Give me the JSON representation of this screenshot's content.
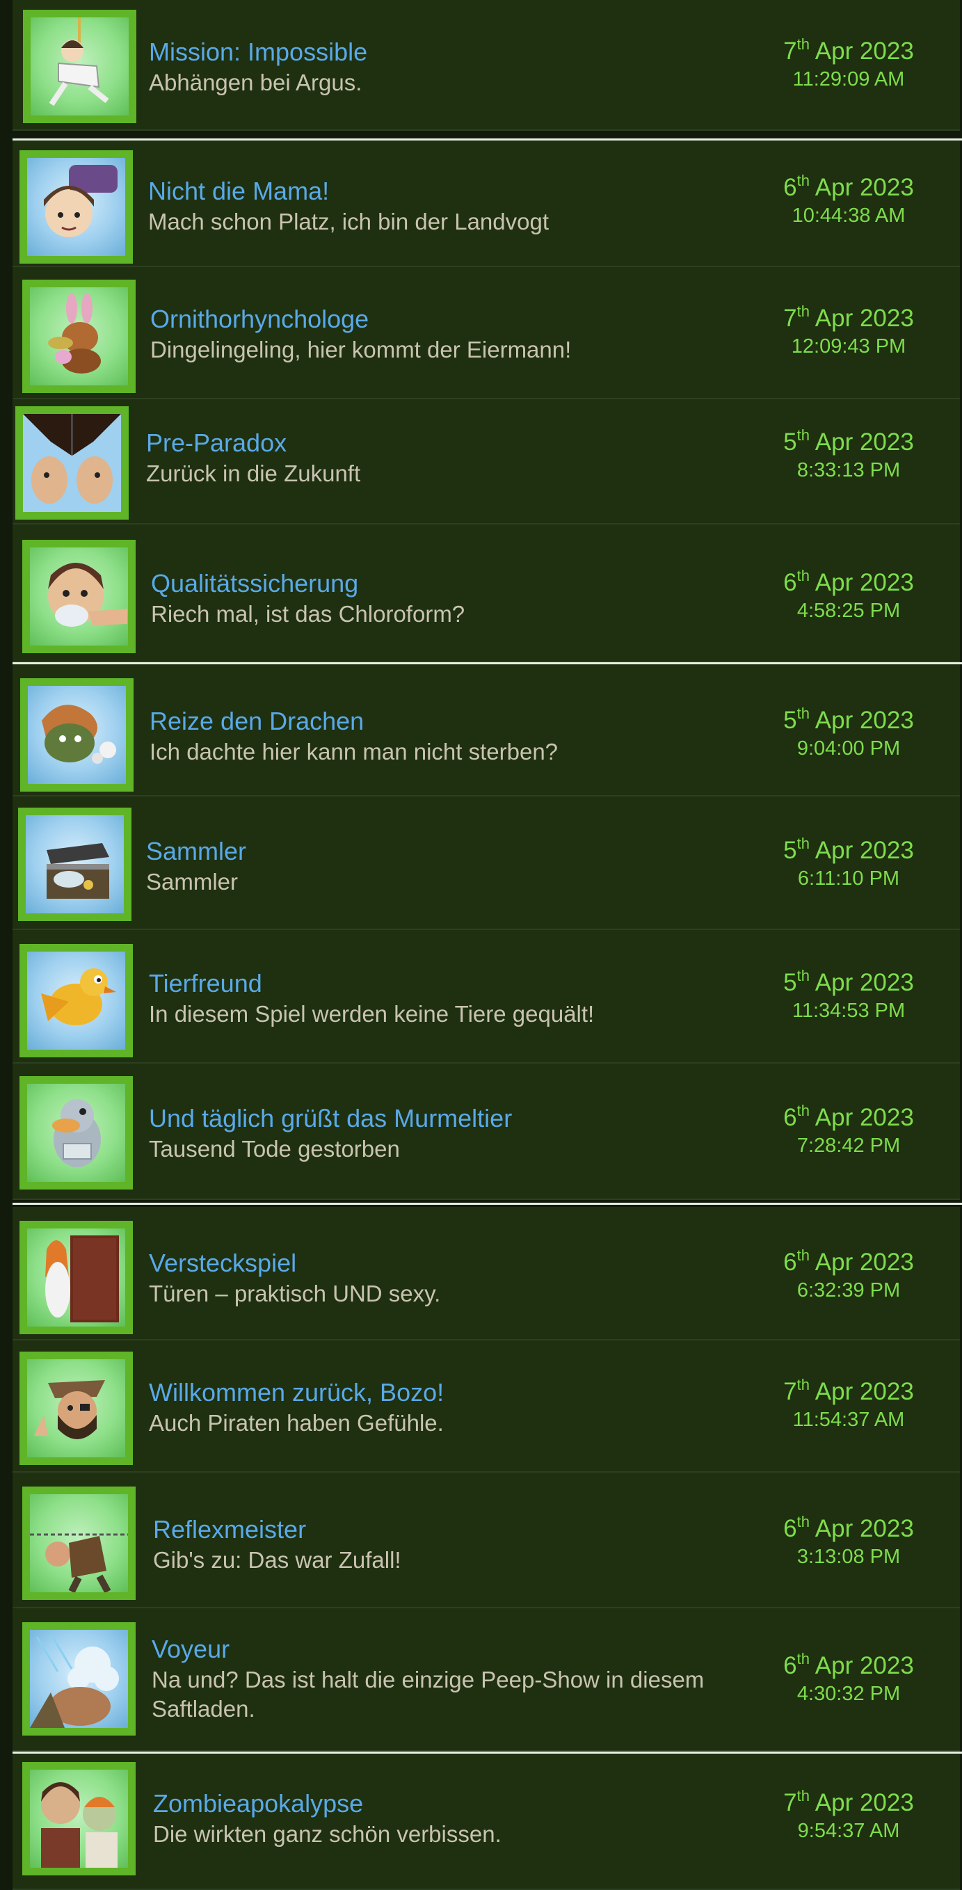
{
  "achievements": [
    {
      "title": "Mission: Impossible",
      "description": "Abhängen bei Argus.",
      "day": "7",
      "suffix": "th",
      "month_year": "Apr 2023",
      "time": "11:29:09 AM",
      "icon": "hanging-character-icon"
    },
    {
      "title": "Nicht die Mama!",
      "description": "Mach schon Platz, ich bin der Landvogt",
      "day": "6",
      "suffix": "th",
      "month_year": "Apr 2023",
      "time": "10:44:38 AM",
      "icon": "hammer-character-icon"
    },
    {
      "title": "Ornithorhynchologe",
      "description": "Dingelingeling, hier kommt der Eiermann!",
      "day": "7",
      "suffix": "th",
      "month_year": "Apr 2023",
      "time": "12:09:43 PM",
      "icon": "bunny-platypus-icon"
    },
    {
      "title": "Pre-Paradox",
      "description": "Zurück in die Zukunft",
      "day": "5",
      "suffix": "th",
      "month_year": "Apr 2023",
      "time": "8:33:13 PM",
      "icon": "two-faces-icon"
    },
    {
      "title": "Qualitätssicherung",
      "description": "Riech mal, ist das Chloroform?",
      "day": "6",
      "suffix": "th",
      "month_year": "Apr 2023",
      "time": "4:58:25 PM",
      "icon": "chloroform-character-icon"
    },
    {
      "title": "Reize den Drachen",
      "description": "Ich dachte hier kann man nicht sterben?",
      "day": "5",
      "suffix": "th",
      "month_year": "Apr 2023",
      "time": "9:04:00 PM",
      "icon": "dragon-icon"
    },
    {
      "title": "Sammler",
      "description": "Sammler",
      "day": "5",
      "suffix": "th",
      "month_year": "Apr 2023",
      "time": "6:11:10 PM",
      "icon": "treasure-chest-icon"
    },
    {
      "title": "Tierfreund",
      "description": "In diesem Spiel werden keine Tiere gequält!",
      "day": "5",
      "suffix": "th",
      "month_year": "Apr 2023",
      "time": "11:34:53 PM",
      "icon": "yellow-bird-icon"
    },
    {
      "title": "Und täglich grüßt das Murmeltier",
      "description": "Tausend Tode gestorben",
      "day": "6",
      "suffix": "th",
      "month_year": "Apr 2023",
      "time": "7:28:42 PM",
      "icon": "platypus-icon"
    },
    {
      "title": "Versteckspiel",
      "description": "Türen – praktisch UND sexy.",
      "day": "6",
      "suffix": "th",
      "month_year": "Apr 2023",
      "time": "6:32:39 PM",
      "icon": "door-woman-icon"
    },
    {
      "title": "Willkommen zurück, Bozo!",
      "description": "Auch Piraten haben Gefühle.",
      "day": "7",
      "suffix": "th",
      "month_year": "Apr 2023",
      "time": "11:54:37 AM",
      "icon": "pirate-icon"
    },
    {
      "title": "Reflexmeister",
      "description": "Gib's zu: Das war Zufall!",
      "day": "6",
      "suffix": "th",
      "month_year": "Apr 2023",
      "time": "3:13:08 PM",
      "icon": "dodging-character-icon"
    },
    {
      "title": "Voyeur",
      "description": "Na und? Das ist halt die einzige Peep-Show in diesem Saftladen.",
      "day": "6",
      "suffix": "th",
      "month_year": "Apr 2023",
      "time": "4:30:32 PM",
      "icon": "shower-icon"
    },
    {
      "title": "Zombieapokalypse",
      "description": "Die wirkten ganz schön verbissen.",
      "day": "7",
      "suffix": "th",
      "month_year": "Apr 2023",
      "time": "9:54:37 AM",
      "icon": "zombies-icon"
    }
  ],
  "colors": {
    "title": "#5aa9e8",
    "description": "#c9c3b0",
    "date": "#7fdc4c",
    "row_background": "#1e3010",
    "icon_frame": "#5fb527"
  }
}
